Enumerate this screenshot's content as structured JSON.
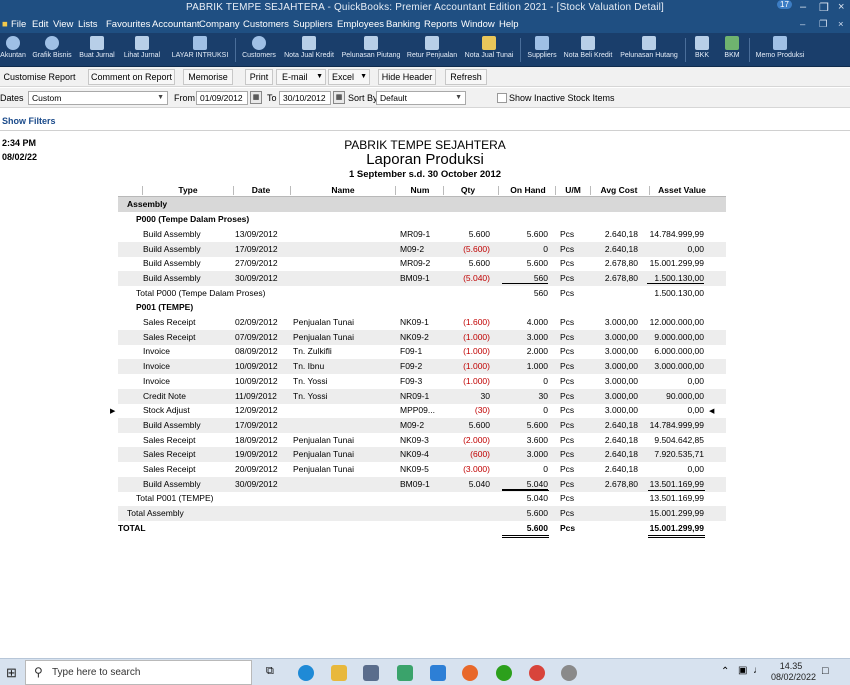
{
  "window": {
    "title": "PABRIK TEMPE SEJAHTERA - QuickBooks: Premier Accountant Edition 2021 - [Stock Valuation Detail]",
    "badge": "17"
  },
  "menu": [
    "File",
    "Edit",
    "View",
    "Lists",
    "Favourites",
    "Accountant",
    "Company",
    "Customers",
    "Suppliers",
    "Employees",
    "Banking",
    "Reports",
    "Window",
    "Help"
  ],
  "icon_bar": [
    "Akuntan",
    "Grafik Bisnis",
    "Buat Jurnal",
    "Lihat Jurnal",
    "LAYAR INTRUKSI",
    "Customers",
    "Nota Jual Kredit",
    "Pelunasan Piutang",
    "Retur Penjualan",
    "Nota Jual Tunai",
    "Suppliers",
    "Nota Beli Kredit",
    "Pelunasan Hutang",
    "BKK",
    "BKM",
    "Memo Produksi"
  ],
  "report_toolbar": {
    "customise": "Customise Report",
    "comment": "Comment on Report",
    "memorise": "Memorise",
    "print": "Print",
    "email": "E-mail",
    "excel": "Excel",
    "hide_header": "Hide Header",
    "refresh": "Refresh"
  },
  "filters": {
    "dates_label": "Dates",
    "dates_value": "Custom",
    "from_label": "From",
    "from_value": "01/09/2012",
    "to_label": "To",
    "to_value": "30/10/2012",
    "sort_label": "Sort By",
    "sort_value": "Default",
    "inactive_label": "Show Inactive Stock Items",
    "show_filters": "Show Filters"
  },
  "report": {
    "time": "2:34 PM",
    "date": "08/02/22",
    "company": "PABRIK TEMPE SEJAHTERA",
    "title": "Laporan Produksi",
    "period": "1 September s.d. 30 October 2012",
    "columns": [
      "Type",
      "Date",
      "Name",
      "Num",
      "Qty",
      "On Hand",
      "U/M",
      "Avg Cost",
      "Asset Value"
    ],
    "group": "Assembly",
    "items": [
      {
        "label": "P000 (Tempe Dalam Proses)",
        "rows": [
          [
            "Build Assembly",
            "13/09/2012",
            "",
            "MR09-1",
            "5.600",
            "5.600",
            "Pcs",
            "2.640,18",
            "14.784.999,99"
          ],
          [
            "Build Assembly",
            "17/09/2012",
            "",
            "M09-2",
            "(5.600)",
            "0",
            "Pcs",
            "2.640,18",
            "0,00"
          ],
          [
            "Build Assembly",
            "27/09/2012",
            "",
            "MR09-2",
            "5.600",
            "5.600",
            "Pcs",
            "2.678,80",
            "15.001.299,99"
          ],
          [
            "Build Assembly",
            "30/09/2012",
            "",
            "BM09-1",
            "(5.040)",
            "560",
            "Pcs",
            "2.678,80",
            "1.500.130,00"
          ]
        ],
        "total_label": "Total P000 (Tempe Dalam Proses)",
        "total_on_hand": "560",
        "total_um": "Pcs",
        "total_value": "1.500.130,00"
      },
      {
        "label": "P001 (TEMPE)",
        "rows": [
          [
            "Sales Receipt",
            "02/09/2012",
            "Penjualan Tunai",
            "NK09-1",
            "(1.600)",
            "4.000",
            "Pcs",
            "3.000,00",
            "12.000.000,00"
          ],
          [
            "Sales Receipt",
            "07/09/2012",
            "Penjualan Tunai",
            "NK09-2",
            "(1.000)",
            "3.000",
            "Pcs",
            "3.000,00",
            "9.000.000,00"
          ],
          [
            "Invoice",
            "08/09/2012",
            "Tn. Zulkifli",
            "F09-1",
            "(1.000)",
            "2.000",
            "Pcs",
            "3.000,00",
            "6.000.000,00"
          ],
          [
            "Invoice",
            "10/09/2012",
            "Tn. Ibnu",
            "F09-2",
            "(1.000)",
            "1.000",
            "Pcs",
            "3.000,00",
            "3.000.000,00"
          ],
          [
            "Invoice",
            "10/09/2012",
            "Tn. Yossi",
            "F09-3",
            "(1.000)",
            "0",
            "Pcs",
            "3.000,00",
            "0,00"
          ],
          [
            "Credit Note",
            "11/09/2012",
            "Tn. Yossi",
            "NR09-1",
            "30",
            "30",
            "Pcs",
            "3.000,00",
            "90.000,00"
          ],
          [
            "Stock Adjust",
            "12/09/2012",
            "",
            "MPP09...",
            "(30)",
            "0",
            "Pcs",
            "3.000,00",
            "0,00"
          ],
          [
            "Build Assembly",
            "17/09/2012",
            "",
            "M09-2",
            "5.600",
            "5.600",
            "Pcs",
            "2.640,18",
            "14.784.999,99"
          ],
          [
            "Sales Receipt",
            "18/09/2012",
            "Penjualan Tunai",
            "NK09-3",
            "(2.000)",
            "3.600",
            "Pcs",
            "2.640,18",
            "9.504.642,85"
          ],
          [
            "Sales Receipt",
            "19/09/2012",
            "Penjualan Tunai",
            "NK09-4",
            "(600)",
            "3.000",
            "Pcs",
            "2.640,18",
            "7.920.535,71"
          ],
          [
            "Sales Receipt",
            "20/09/2012",
            "Penjualan Tunai",
            "NK09-5",
            "(3.000)",
            "0",
            "Pcs",
            "2.640,18",
            "0,00"
          ],
          [
            "Build Assembly",
            "30/09/2012",
            "",
            "BM09-1",
            "5.040",
            "5.040",
            "Pcs",
            "2.678,80",
            "13.501.169,99"
          ]
        ],
        "total_label": "Total P001 (TEMPE)",
        "total_on_hand": "5.040",
        "total_um": "Pcs",
        "total_value": "13.501.169,99"
      }
    ],
    "group_total": {
      "label": "Total Assembly",
      "on_hand": "5.600",
      "um": "Pcs",
      "value": "15.001.299,99"
    },
    "grand_total": {
      "label": "TOTAL",
      "on_hand": "5.600",
      "um": "Pcs",
      "value": "15.001.299,99"
    }
  },
  "taskbar": {
    "search_placeholder": "Type here to search",
    "time": "14.35",
    "date": "08/02/2022"
  }
}
